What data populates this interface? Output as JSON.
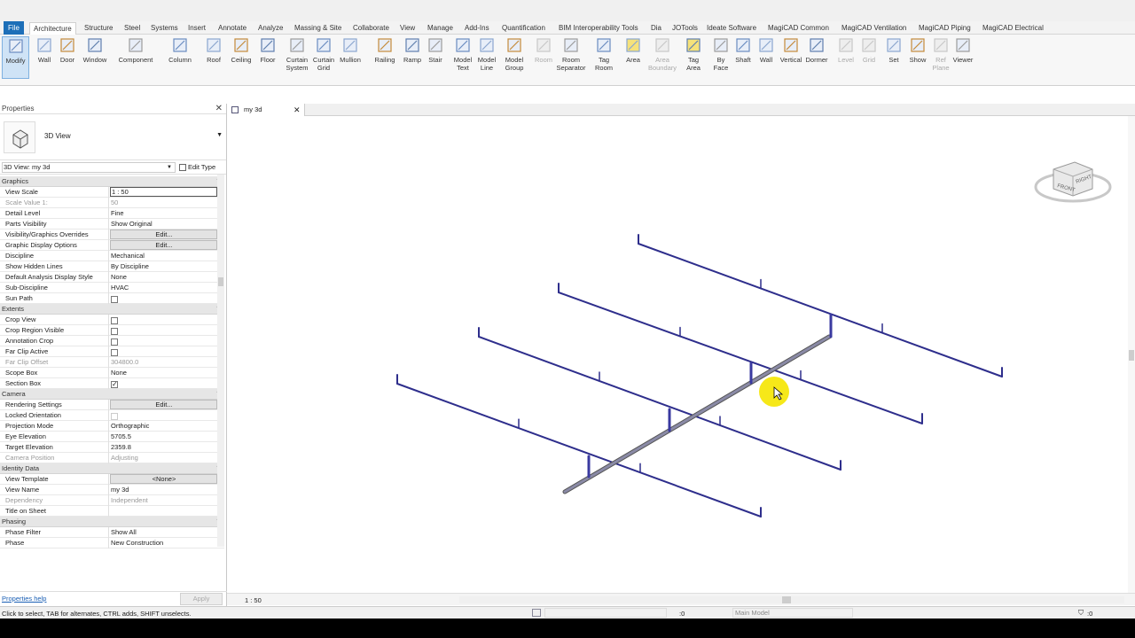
{
  "tabs": [
    "File",
    "Architecture",
    "Structure",
    "Steel",
    "Systems",
    "Insert",
    "Annotate",
    "Analyze",
    "Massing & Site",
    "Collaborate",
    "View",
    "Manage",
    "Add-Ins",
    "Quantification",
    "BIM Interoperability Tools",
    "Dia",
    "JOTools",
    "Ideate Software",
    "MagiCAD Common",
    "MagiCAD Ventilation",
    "MagiCAD Piping",
    "MagiCAD Electrical"
  ],
  "tools": {
    "modify": "Modify",
    "wall": "Wall",
    "door": "Door",
    "window": "Window",
    "component": "Component",
    "column": "Column",
    "roof": "Roof",
    "ceiling": "Ceiling",
    "floor": "Floor",
    "curtain_system": "Curtain System",
    "curtain_grid": "Curtain Grid",
    "mullion": "Mullion",
    "railing": "Railing",
    "ramp": "Ramp",
    "stair": "Stair",
    "model_text": "Model Text",
    "model_line": "Model Line",
    "model_group": "Model Group",
    "room": "Room",
    "room_separator": "Room Separator",
    "tag_room": "Tag Room",
    "area": "Area",
    "area_boundary": "Area Boundary",
    "tag_area": "Tag Area",
    "by_face": "By Face",
    "shaft": "Shaft",
    "wall2": "Wall",
    "vertical": "Vertical",
    "dormer": "Dormer",
    "level": "Level",
    "grid": "Grid",
    "set": "Set",
    "show": "Show",
    "ref_plane": "Ref Plane",
    "viewer": "Viewer"
  },
  "properties": {
    "title": "Properties",
    "type_name": "3D View",
    "instance": "3D View: my 3d",
    "edit_type": "Edit Type",
    "sections": [
      {
        "name": "Graphics",
        "rows": [
          {
            "k": "View Scale",
            "v": "1 : 50",
            "t": "input"
          },
          {
            "k": "Scale Value    1:",
            "v": "50",
            "t": "dis"
          },
          {
            "k": "Detail Level",
            "v": "Fine"
          },
          {
            "k": "Parts Visibility",
            "v": "Show Original"
          },
          {
            "k": "Visibility/Graphics Overrides",
            "v": "Edit...",
            "t": "btn"
          },
          {
            "k": "Graphic Display Options",
            "v": "Edit...",
            "t": "btn"
          },
          {
            "k": "Discipline",
            "v": "Mechanical"
          },
          {
            "k": "Show Hidden Lines",
            "v": "By Discipline"
          },
          {
            "k": "Default Analysis Display Style",
            "v": "None"
          },
          {
            "k": "Sub-Discipline",
            "v": "HVAC"
          },
          {
            "k": "Sun Path",
            "v": "",
            "t": "cb"
          }
        ]
      },
      {
        "name": "Extents",
        "rows": [
          {
            "k": "Crop View",
            "v": "",
            "t": "cb"
          },
          {
            "k": "Crop Region Visible",
            "v": "",
            "t": "cb"
          },
          {
            "k": "Annotation Crop",
            "v": "",
            "t": "cb"
          },
          {
            "k": "Far Clip Active",
            "v": "",
            "t": "cb"
          },
          {
            "k": "Far Clip Offset",
            "v": "304800.0",
            "t": "dis"
          },
          {
            "k": "Scope Box",
            "v": "None"
          },
          {
            "k": "Section Box",
            "v": "",
            "t": "cbon"
          }
        ]
      },
      {
        "name": "Camera",
        "rows": [
          {
            "k": "Rendering Settings",
            "v": "Edit...",
            "t": "btn"
          },
          {
            "k": "Locked Orientation",
            "v": "",
            "t": "cbdis"
          },
          {
            "k": "Projection Mode",
            "v": "Orthographic"
          },
          {
            "k": "Eye Elevation",
            "v": "5705.5"
          },
          {
            "k": "Target Elevation",
            "v": "2359.8"
          },
          {
            "k": "Camera Position",
            "v": "Adjusting",
            "t": "dis"
          }
        ]
      },
      {
        "name": "Identity Data",
        "rows": [
          {
            "k": "View Template",
            "v": "<None>",
            "t": "btn"
          },
          {
            "k": "View Name",
            "v": "my 3d"
          },
          {
            "k": "Dependency",
            "v": "Independent",
            "t": "dis"
          },
          {
            "k": "Title on Sheet",
            "v": ""
          }
        ]
      },
      {
        "name": "Phasing",
        "rows": [
          {
            "k": "Phase Filter",
            "v": "Show All"
          },
          {
            "k": "Phase",
            "v": "New Construction"
          }
        ]
      }
    ],
    "help": "Properties help",
    "apply": "Apply"
  },
  "view_tab": "my 3d",
  "viewcube": {
    "front": "FRONT",
    "right": "RIGHT",
    "top": "TOP"
  },
  "view_scale": "1 : 50",
  "status_text": "Click to select, TAB for alternates, CTRL adds, SHIFT unselects.",
  "status_zero": ":0",
  "workset": "Main Model",
  "filter_count": ":0",
  "colors": {
    "pipe": "#2e2e8c",
    "riser": "#3a3aa0",
    "main": "#8a8aa6",
    "cursor_highlight": "#f5e600"
  }
}
